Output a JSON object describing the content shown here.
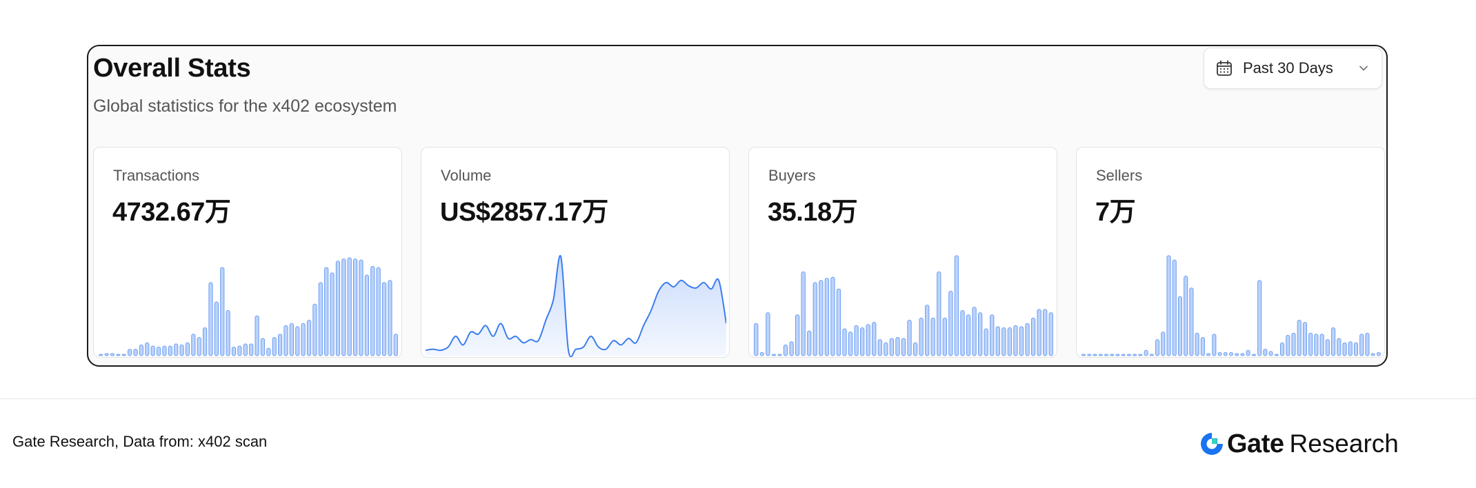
{
  "panel": {
    "title": "Overall Stats",
    "subtitle": "Global statistics for the x402 ecosystem",
    "range_select": {
      "value": "Past 30 Days",
      "icon": "calendar-icon",
      "chevron": "chevron-down-icon"
    }
  },
  "cards": [
    {
      "label": "Transactions",
      "value": "4732.67万",
      "chart": "bar",
      "values": [
        1,
        2,
        2,
        0,
        1,
        6,
        6,
        10,
        12,
        9,
        8,
        9,
        9,
        11,
        10,
        12,
        20,
        17,
        26,
        68,
        50,
        82,
        42,
        8,
        9,
        11,
        11,
        37,
        16,
        7,
        17,
        20,
        28,
        30,
        27,
        30,
        33,
        48,
        68,
        82,
        77,
        88,
        90,
        91,
        90,
        89,
        75,
        83,
        82,
        68,
        70,
        20
      ]
    },
    {
      "label": "Volume",
      "value": "US$2857.17万",
      "chart": "area",
      "values": [
        5,
        6,
        5,
        8,
        18,
        10,
        22,
        20,
        28,
        18,
        30,
        16,
        18,
        12,
        15,
        14,
        33,
        52,
        92,
        5,
        6,
        8,
        18,
        8,
        6,
        14,
        10,
        16,
        12,
        28,
        42,
        60,
        68,
        64,
        70,
        65,
        63,
        68,
        62,
        70,
        30
      ]
    },
    {
      "label": "Buyers",
      "value": "35.18万",
      "chart": "bar",
      "values": [
        30,
        3,
        40,
        0,
        1,
        10,
        13,
        38,
        78,
        23,
        68,
        70,
        72,
        73,
        62,
        25,
        22,
        28,
        26,
        29,
        31,
        15,
        12,
        16,
        17,
        16,
        33,
        12,
        35,
        47,
        35,
        78,
        35,
        60,
        93,
        42,
        38,
        45,
        40,
        25,
        38,
        27,
        26,
        26,
        28,
        27,
        30,
        35,
        43,
        43,
        40
      ]
    },
    {
      "label": "Sellers",
      "value": "7万",
      "chart": "bar",
      "values": [
        0,
        0,
        0,
        0,
        0,
        0,
        1,
        1,
        1,
        1,
        1,
        5,
        1,
        15,
        22,
        93,
        89,
        55,
        74,
        63,
        21,
        17,
        2,
        20,
        3,
        3,
        3,
        2,
        2,
        5,
        1,
        70,
        6,
        4,
        1,
        12,
        19,
        21,
        33,
        31,
        21,
        20,
        20,
        15,
        26,
        16,
        12,
        13,
        12,
        20,
        21,
        2,
        3
      ]
    }
  ],
  "footer": {
    "source": "Gate Research, Data from: x402 scan",
    "brand_gate": "Gate",
    "brand_research": "Research",
    "logo_icon": "gate-logo-icon"
  },
  "colors": {
    "bar_fill": "#bcd3fb",
    "bar_stroke": "#6b9df2",
    "line": "#3b7ded",
    "area_top": "#c9dbfb",
    "area_bottom": "#f4f8ff",
    "logo_blue": "#1a73f0"
  }
}
